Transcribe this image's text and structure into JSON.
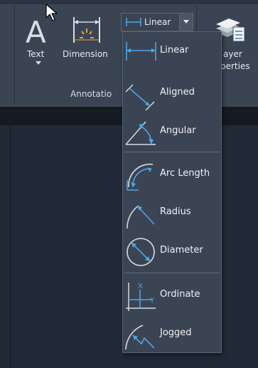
{
  "ribbon": {
    "tools": {
      "text_label": "Text",
      "dimension_label": "Dimension"
    },
    "annotation_panel_title": "Annotatio",
    "right_panel": {
      "line1": "ayer",
      "line2": "perties"
    }
  },
  "dimension_dropdown": {
    "selected_label": "Linear",
    "options": [
      {
        "label": "Linear",
        "icon": "linear-dimension-icon"
      },
      {
        "label": "Aligned",
        "icon": "aligned-dimension-icon"
      },
      {
        "label": "Angular",
        "icon": "angular-dimension-icon"
      },
      {
        "label": "Arc Length",
        "icon": "arc-length-dimension-icon"
      },
      {
        "label": "Radius",
        "icon": "radius-dimension-icon"
      },
      {
        "label": "Diameter",
        "icon": "diameter-dimension-icon"
      },
      {
        "label": "Ordinate",
        "icon": "ordinate-dimension-icon"
      },
      {
        "label": "Jogged",
        "icon": "jogged-dimension-icon"
      }
    ]
  },
  "colors": {
    "ribbon_bg": "#3b4453",
    "canvas_bg": "#212a36",
    "icon_blue": "#4aa8e8",
    "accent_orange": "#e8a33a"
  }
}
